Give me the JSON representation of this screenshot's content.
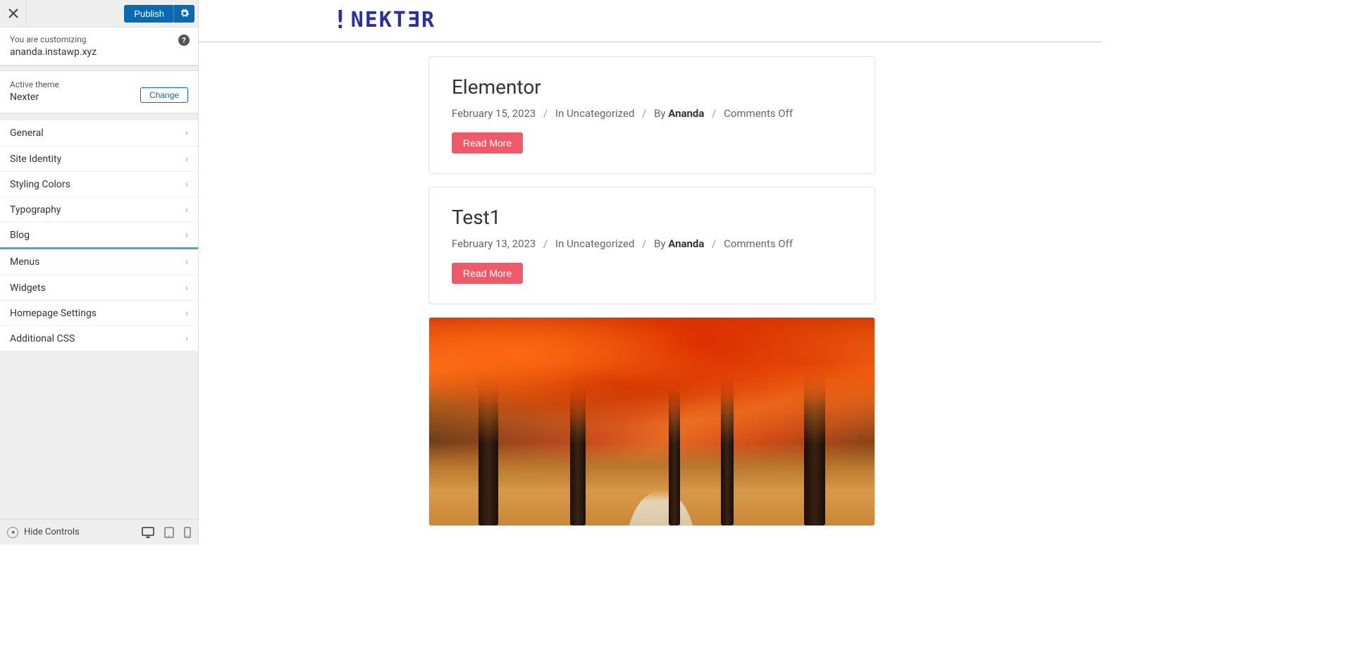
{
  "header": {
    "publish_label": "Publish"
  },
  "current_site": {
    "label": "You are customizing",
    "sitename": "ananda.instawp.xyz"
  },
  "theme": {
    "label": "Active theme",
    "name": "Nexter",
    "change_label": "Change"
  },
  "menu": {
    "group1": [
      "General",
      "Site Identity",
      "Styling Colors",
      "Typography",
      "Blog"
    ],
    "group2": [
      "Menus",
      "Widgets",
      "Homepage Settings",
      "Additional CSS"
    ]
  },
  "footer": {
    "hide_controls": "Hide Controls"
  },
  "site": {
    "logo_text": "NEKTƎR"
  },
  "posts": [
    {
      "title": "Elementor",
      "date": "February 15, 2023",
      "category_prefix": "In ",
      "category": "Uncategorized",
      "by_prefix": "By ",
      "author": "Ananda",
      "comments": "Comments Off",
      "read_more": "Read More"
    },
    {
      "title": "Test1",
      "date": "February 13, 2023",
      "category_prefix": "In ",
      "category": "Uncategorized",
      "by_prefix": "By ",
      "author": "Ananda",
      "comments": "Comments Off",
      "read_more": "Read More"
    }
  ]
}
